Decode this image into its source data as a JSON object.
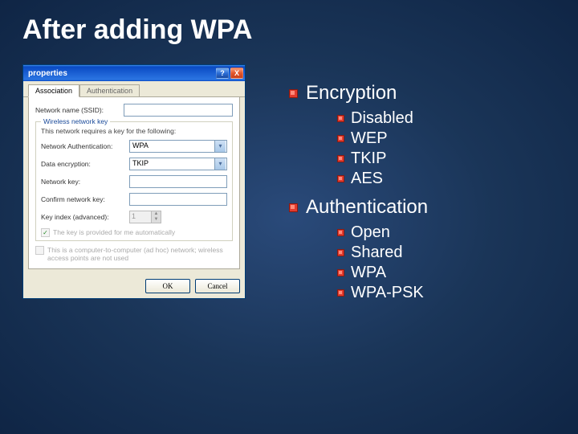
{
  "slide": {
    "title": "After adding WPA"
  },
  "dialog": {
    "title": "properties",
    "help": "?",
    "close": "X",
    "tabs": {
      "assoc": "Association",
      "auth": "Authentication"
    },
    "ssid_label": "Network name (SSID):",
    "ssid_value": "",
    "group_title": "Wireless network key",
    "group_desc": "This network requires a key for the following:",
    "auth_label": "Network Authentication:",
    "auth_value": "WPA",
    "enc_label": "Data encryption:",
    "enc_value": "TKIP",
    "key_label": "Network key:",
    "confirm_label": "Confirm network key:",
    "index_label": "Key index (advanced):",
    "index_value": "1",
    "auto_key": "The key is provided for me automatically",
    "adhoc": "This is a computer-to-computer (ad hoc) network; wireless access points are not used",
    "ok": "OK",
    "cancel": "Cancel"
  },
  "bullets": {
    "enc_header": "Encryption",
    "enc_items": [
      "Disabled",
      "WEP",
      "TKIP",
      "AES"
    ],
    "auth_header": "Authentication",
    "auth_items": [
      "Open",
      "Shared",
      "WPA",
      "WPA-PSK"
    ]
  }
}
